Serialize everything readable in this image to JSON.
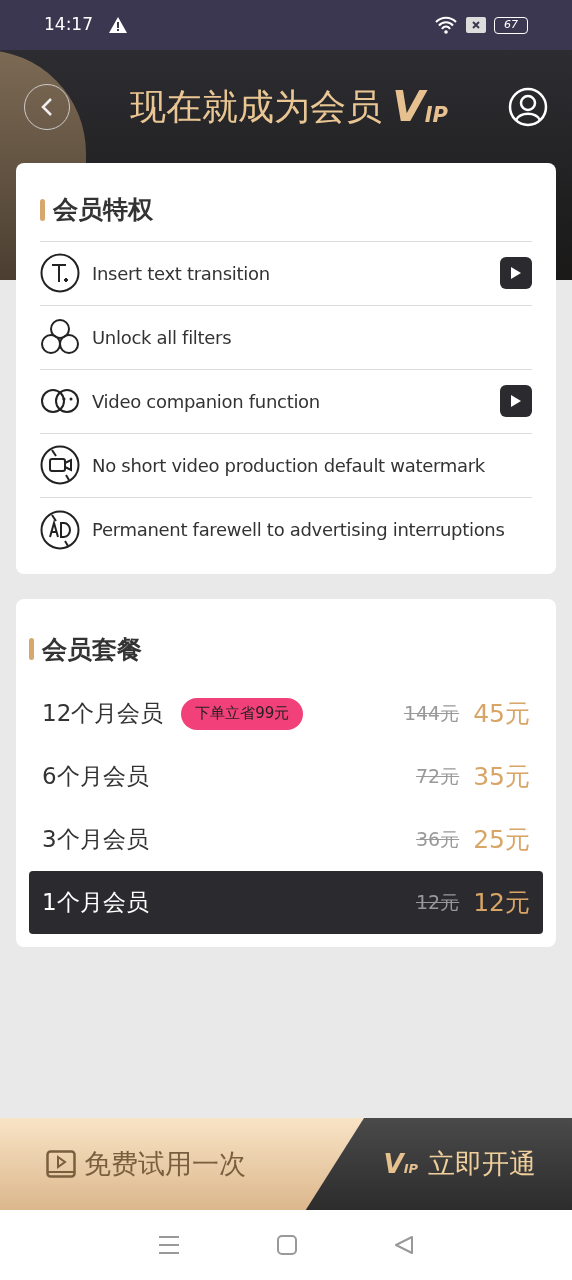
{
  "status_bar": {
    "time": "14:17",
    "battery": "67"
  },
  "header": {
    "title": "现在就成为会员",
    "logo_big": "V",
    "logo_small": "IP"
  },
  "privileges": {
    "title": "会员特权",
    "items": [
      {
        "kind": "text",
        "label": "Insert text transition",
        "has_video": true
      },
      {
        "kind": "filters",
        "label": "Unlock all filters",
        "has_video": false
      },
      {
        "kind": "companion",
        "label": "Video companion function",
        "has_video": true
      },
      {
        "kind": "watermark",
        "label": "No short video production default watermark",
        "has_video": false
      },
      {
        "kind": "ad",
        "label": "Permanent farewell to advertising interruptions",
        "has_video": false
      }
    ]
  },
  "plans": {
    "title": "会员套餐",
    "items": [
      {
        "name": "12个月会员",
        "badge": "下单立省99元",
        "original_price": "144元",
        "price": "45元",
        "selected": false
      },
      {
        "name": "6个月会员",
        "original_price": "72元",
        "price": "35元",
        "selected": false
      },
      {
        "name": "3个月会员",
        "original_price": "36元",
        "price": "25元",
        "selected": false
      },
      {
        "name": "1个月会员",
        "original_price": "12元",
        "price": "12元",
        "selected": true
      }
    ]
  },
  "bottom_bar": {
    "trial": "免费试用一次",
    "open_logo_big": "V",
    "open_logo_small": "IP",
    "open": "立即开通"
  }
}
